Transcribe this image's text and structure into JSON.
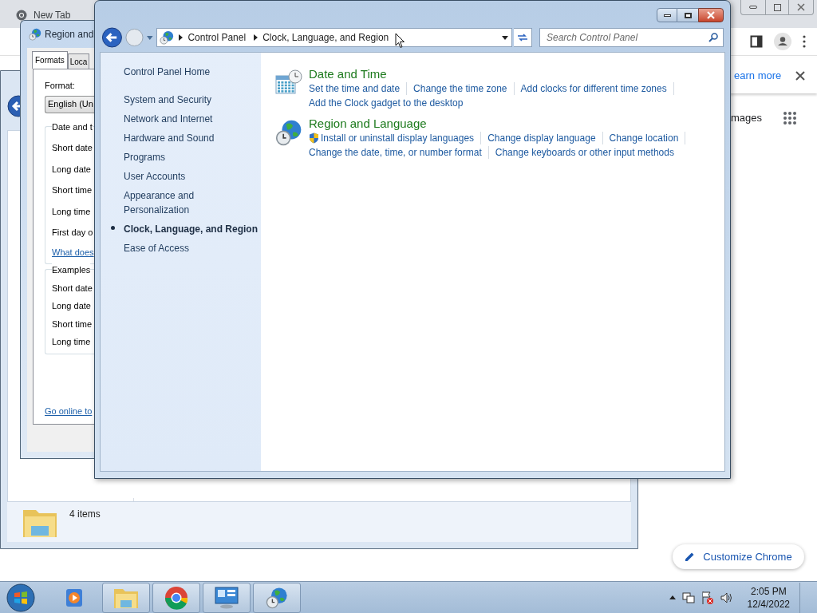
{
  "chrome": {
    "tab_title": "New Tab",
    "banner_link": "earn more",
    "shortcut_label": "mages",
    "customize_button": "Customize Chrome"
  },
  "explorer": {
    "status": "4 items"
  },
  "region_dialog": {
    "title": "Region and",
    "tabs": [
      {
        "label": "Formats",
        "selected": true
      },
      {
        "label": "Loca",
        "selected": false
      }
    ],
    "format_label": "Format:",
    "format_value": "English (Un",
    "groups": [
      {
        "title": "Date and t",
        "rows": [
          "Short date",
          "Long date",
          "Short time",
          "Long time",
          "First day o"
        ],
        "link": "What does"
      },
      {
        "title": "Examples",
        "rows": [
          "Short date",
          "Long date",
          "Short time",
          "Long time"
        ]
      }
    ],
    "footer_link": "Go online to"
  },
  "control_panel": {
    "breadcrumb": [
      "Control Panel",
      "Clock, Language, and Region"
    ],
    "search": {
      "placeholder": "Search Control Panel"
    },
    "sidebar": {
      "home": "Control Panel Home",
      "items": [
        {
          "label": "System and Security",
          "selected": false
        },
        {
          "label": "Network and Internet",
          "selected": false
        },
        {
          "label": "Hardware and Sound",
          "selected": false
        },
        {
          "label": "Programs",
          "selected": false
        },
        {
          "label": "User Accounts",
          "selected": false
        },
        {
          "label": "Appearance and Personalization",
          "selected": false
        },
        {
          "label": "Clock, Language, and Region",
          "selected": true
        },
        {
          "label": "Ease of Access",
          "selected": false
        }
      ]
    },
    "sections": [
      {
        "kind": "clock",
        "title": "Date and Time",
        "links": [
          {
            "label": "Set the time and date",
            "shield": false
          },
          {
            "label": "Change the time zone",
            "shield": false
          },
          {
            "label": "Add clocks for different time zones",
            "shield": false
          },
          {
            "label": "Add the Clock gadget to the desktop",
            "shield": false
          }
        ]
      },
      {
        "kind": "globe",
        "title": "Region and Language",
        "links": [
          {
            "label": "Install or uninstall display languages",
            "shield": true
          },
          {
            "label": "Change display language",
            "shield": false
          },
          {
            "label": "Change location",
            "shield": false
          },
          {
            "label": "Change the date, time, or number format",
            "shield": false
          },
          {
            "label": "Change keyboards or other input methods",
            "shield": false
          }
        ]
      }
    ]
  },
  "taskbar": {
    "time": "2:05 PM",
    "date": "12/4/2022"
  }
}
